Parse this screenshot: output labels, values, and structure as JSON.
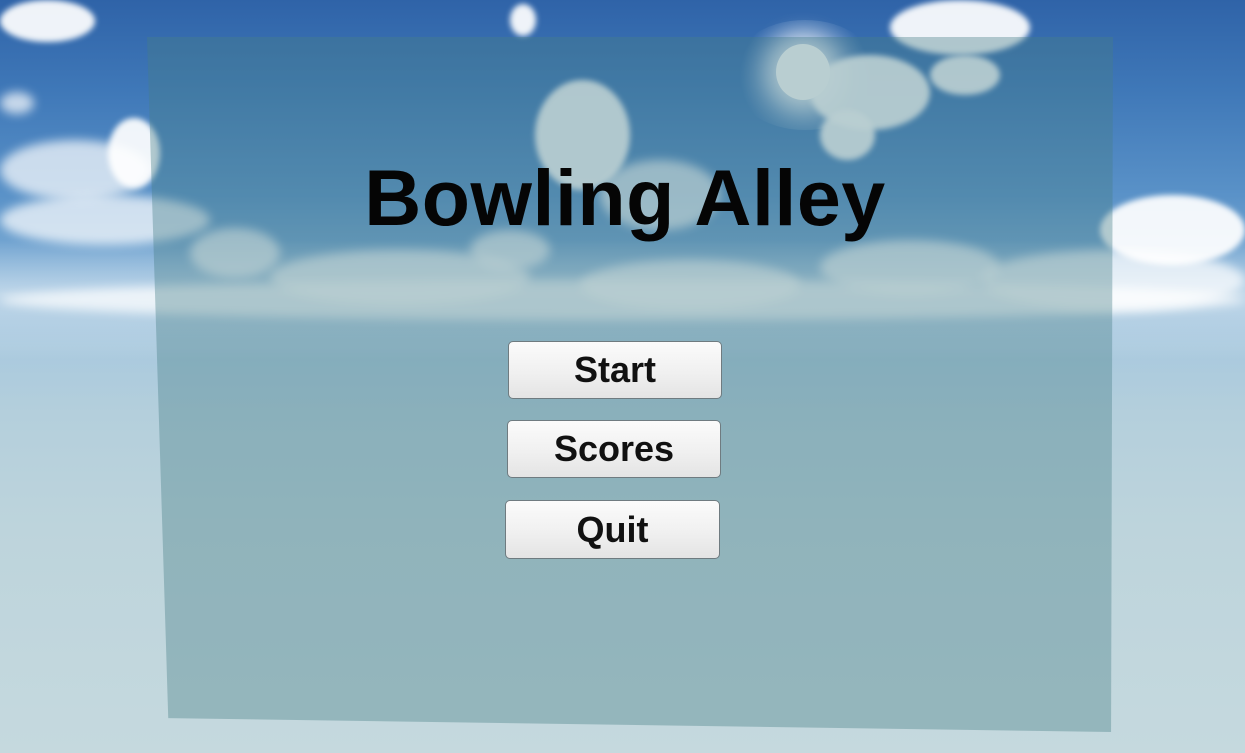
{
  "menu": {
    "title": "Bowling Alley",
    "buttons": {
      "start": "Start",
      "scores": "Scores",
      "quit": "Quit"
    }
  },
  "colors": {
    "sky_top": "#2f63a8",
    "panel_tint": "#467d87",
    "button_fill": "#f0f0f0",
    "text": "#050505"
  }
}
